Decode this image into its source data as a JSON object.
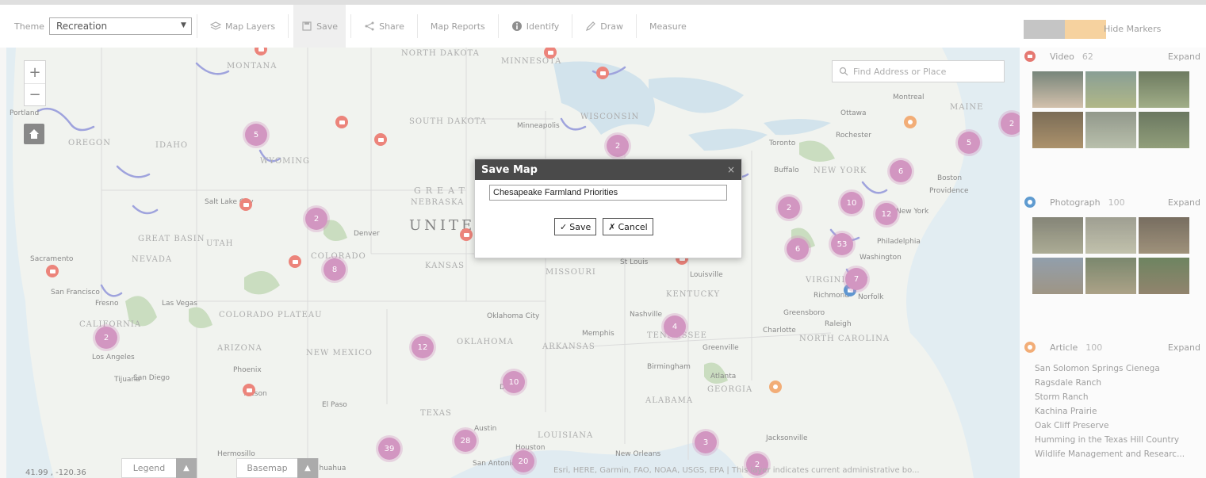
{
  "toolbar": {
    "theme_label": "Theme",
    "theme_value": "Recreation",
    "buttons": [
      {
        "label": "Map Layers"
      },
      {
        "label": "Save"
      },
      {
        "label": "Share"
      },
      {
        "label": "Map Reports"
      },
      {
        "label": "Identify"
      },
      {
        "label": "Draw"
      },
      {
        "label": "Measure"
      }
    ],
    "swatch_colors": [
      "#b9b9b9",
      "#f4c98a"
    ],
    "hide_markers_label": "Hide Markers"
  },
  "map": {
    "search_placeholder": "Find Address or Place",
    "zoom_in": "+",
    "zoom_out": "−",
    "coordinates": "41.99 , -120.36",
    "legend_label": "Legend",
    "basemap_label": "Basemap",
    "attribution": "Esri, HERE, Garmin, FAO, NOAA, USGS, EPA | This layer indicates current administrative bo...",
    "state_labels": [
      "MONTANA",
      "NORTH DAKOTA",
      "MINNESOTA",
      "SOUTH DAKOTA",
      "WISCONSIN",
      "IDAHO",
      "WYOMING",
      "OREGON",
      "NEBRASKA",
      "NEW YORK",
      "UTAH",
      "GREAT BASIN",
      "NEVADA",
      "COLORADO",
      "KANSAS",
      "MISSOURI",
      "KENTUCKY",
      "VIRGINIA",
      "CALIFORNIA",
      "COLORADO PLATEAU",
      "ARIZONA",
      "NEW MEXICO",
      "OKLAHOMA",
      "ARKANSAS",
      "TENNESSEE",
      "NORTH CAROLINA",
      "ALABAMA",
      "GEORGIA",
      "TEXAS",
      "LOUISIANA",
      "MAINE",
      "UNITED STATES",
      "GREAT PLAINS"
    ],
    "city_labels": [
      "Portland",
      "Minneapolis",
      "Montreal",
      "Ottawa",
      "Toronto",
      "Rochester",
      "Buffalo",
      "Boston",
      "Providence",
      "New York",
      "Philadelphia",
      "Washington",
      "Richmond",
      "Norfolk",
      "Raleigh",
      "Charlotte",
      "Greensboro",
      "Greenville",
      "Atlanta",
      "Birmingham",
      "Memphis",
      "Nashville",
      "Louisville",
      "St Louis",
      "Denver",
      "Salt Lake City",
      "Sacramento",
      "San Francisco",
      "Fresno",
      "Las Vegas",
      "Los Angeles",
      "San Diego",
      "Tijuana",
      "Phoenix",
      "Tucson",
      "El Paso",
      "Oklahoma City",
      "Dallas",
      "Austin",
      "Houston",
      "San Antonio",
      "New Orleans",
      "Jacksonville",
      "Hermosillo",
      "Chihuahua"
    ],
    "clusters": [
      "5",
      "2",
      "8",
      "2",
      "12",
      "10",
      "28",
      "39",
      "20",
      "2",
      "2",
      "6",
      "10",
      "12",
      "6",
      "53",
      "7",
      "4",
      "3",
      "5",
      "2",
      "2"
    ]
  },
  "modal": {
    "title": "Save Map",
    "close": "×",
    "input_value": "Chesapeake Farmland Priorities",
    "save_label": "Save",
    "cancel_label": "Cancel"
  },
  "panel": {
    "video": {
      "label": "Video",
      "count": "62",
      "expand": "Expand",
      "color": "#e05b52"
    },
    "photograph": {
      "label": "Photograph",
      "count": "100",
      "expand": "Expand",
      "color": "#3c86c6"
    },
    "article": {
      "label": "Article",
      "count": "100",
      "expand": "Expand",
      "color": "#ef9b5a",
      "items": [
        "San Solomon Springs Cienega",
        "Ragsdale Ranch",
        "Storm Ranch",
        "Kachina Prairie",
        "Oak Cliff Preserve",
        "Humming in the Texas Hill Country",
        "Wildlife Management and Researc..."
      ]
    }
  }
}
